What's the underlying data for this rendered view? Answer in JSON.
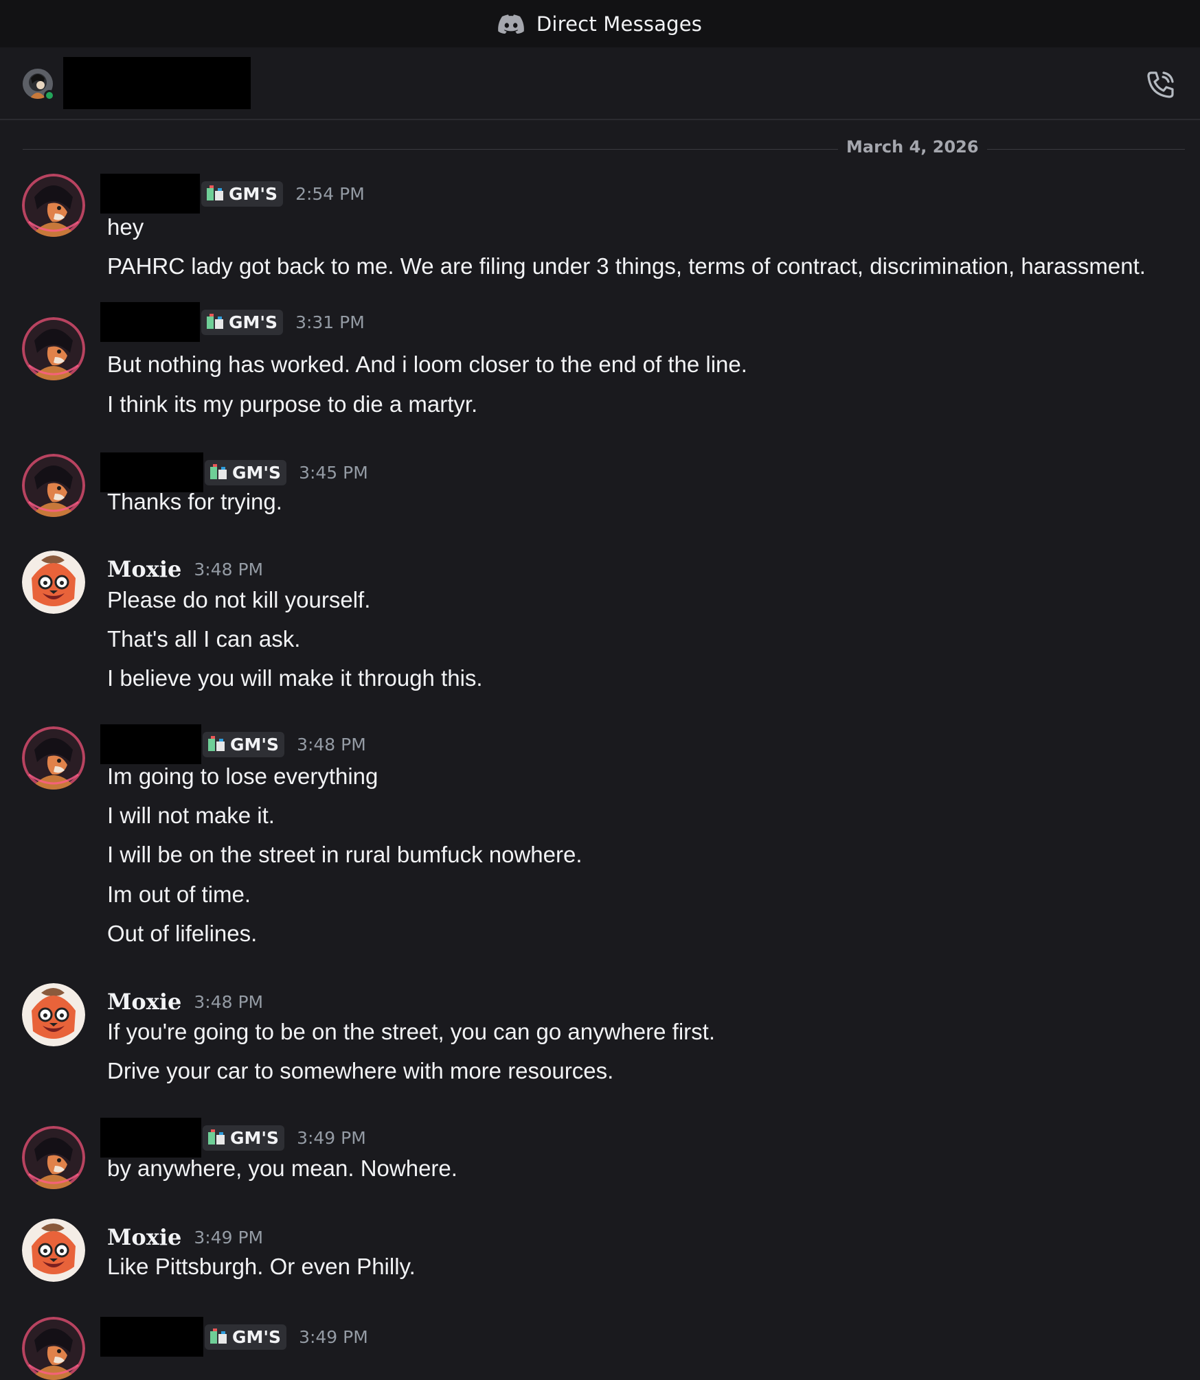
{
  "titlebar": {
    "title": "Direct Messages",
    "icon": "discord-icon"
  },
  "dm_header": {
    "avatar": "user-avatar",
    "status": "online",
    "name_redacted": true,
    "call_icon": "phone-call-icon"
  },
  "date_divider": "March 4, 2026",
  "colors": {
    "background": "#1a1a1e",
    "titlebar": "#121214",
    "online": "#23a55a",
    "tag_bg": "#2e2f34",
    "timestamp": "#949ba4"
  },
  "messages": [
    {
      "author": "",
      "tag": "GM'S",
      "time": "2:54 PM",
      "lines": [
        "hey",
        "PAHRC lady got back to me. We are filing under 3 things, terms of contract, discrimination, harassment."
      ]
    },
    {
      "author": "",
      "tag": "GM'S",
      "time": "3:31 PM",
      "lines": [
        "But nothing has worked. And i loom closer to the end of the line.",
        "I think its my purpose to die a martyr."
      ]
    },
    {
      "author": "",
      "tag": "GM'S",
      "time": "3:45 PM",
      "lines": [
        "Thanks for trying."
      ]
    },
    {
      "author": "Moxie",
      "tag": "",
      "time": "3:48 PM",
      "lines": [
        "Please do not kill yourself.",
        "That's all I can ask.",
        "I believe you will make it through this."
      ]
    },
    {
      "author": "",
      "tag": "GM'S",
      "time": "3:48 PM",
      "lines": [
        "Im going to lose everything",
        "I will not make it.",
        "I will be on the street in rural bumfuck nowhere.",
        "Im out of time.",
        "Out of lifelines."
      ]
    },
    {
      "author": "Moxie",
      "tag": "",
      "time": "3:48 PM",
      "lines": [
        "If you're going to be on the street, you can go anywhere first.",
        "Drive your car to somewhere with more resources."
      ]
    },
    {
      "author": "",
      "tag": "GM'S",
      "time": "3:49 PM",
      "lines": [
        "by anywhere, you mean. Nowhere."
      ]
    },
    {
      "author": "Moxie",
      "tag": "",
      "time": "3:49 PM",
      "lines": [
        "Like Pittsburgh. Or even Philly."
      ]
    },
    {
      "author": "",
      "tag": "GM'S",
      "time": "3:49 PM",
      "lines": []
    }
  ]
}
